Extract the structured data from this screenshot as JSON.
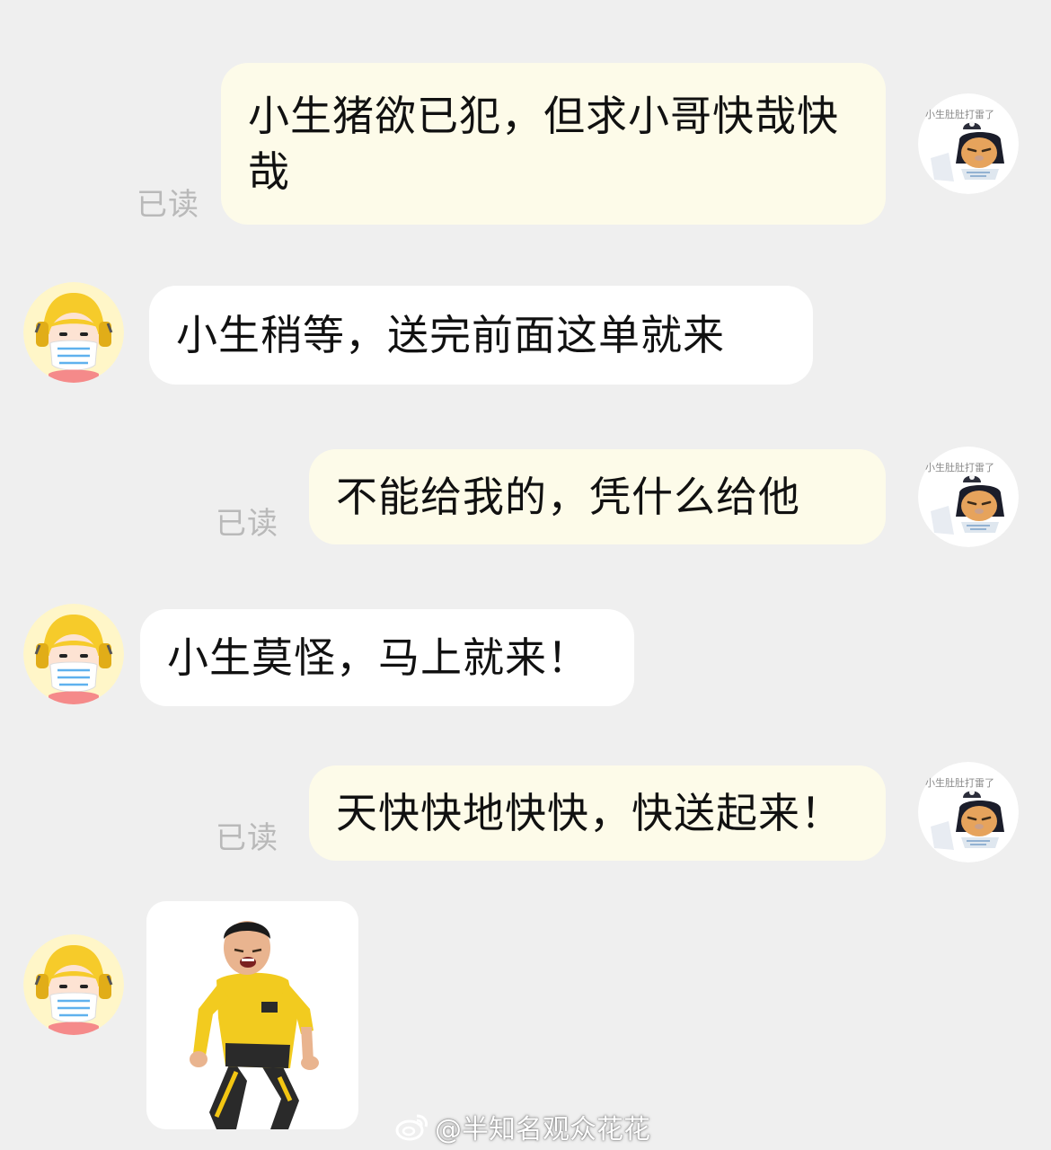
{
  "messages": [
    {
      "side": "right",
      "text": "小生猪欲已犯，但求小哥快哉快哉",
      "status": "已读"
    },
    {
      "side": "left",
      "text": "小生稍等，送完前面这单就来"
    },
    {
      "side": "right",
      "text": "不能给我的，凭什么给他",
      "status": "已读"
    },
    {
      "side": "left",
      "text": "小生莫怪，马上就来！"
    },
    {
      "side": "right",
      "text": "天快快地快快，快送起来！",
      "status": "已读"
    },
    {
      "side": "left",
      "sticker": "running-courier-sticker"
    }
  ],
  "user_avatar": {
    "caption": "小生肚肚打雷了",
    "icon": "cat-avatar-icon"
  },
  "courier_avatar": {
    "icon": "courier-helmet-avatar-icon",
    "color": "#f6cb2a"
  },
  "watermark": {
    "text": "@半知名观众花花",
    "icon": "weibo-icon"
  },
  "colors": {
    "background": "#efefef",
    "outgoing_bubble": "#fdfbe9",
    "incoming_bubble": "#ffffff",
    "read_status": "#b9b9b9"
  }
}
